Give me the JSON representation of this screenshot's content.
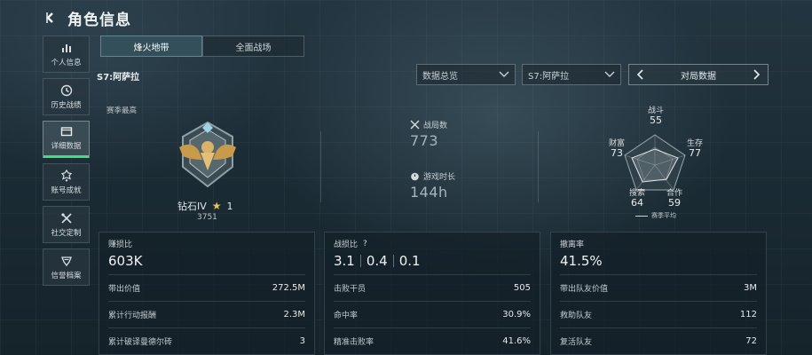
{
  "header": {
    "title": "角色信息"
  },
  "sidebar": {
    "items": [
      {
        "label": "个人信息"
      },
      {
        "label": "历史战绩"
      },
      {
        "label": "详细数据"
      },
      {
        "label": "账号成就"
      },
      {
        "label": "社交定制"
      },
      {
        "label": "信誉档案"
      }
    ],
    "active_index": 2,
    "accent_color": "#3de07a"
  },
  "tabs": [
    {
      "label": "烽火地带"
    },
    {
      "label": "全面战场"
    }
  ],
  "season": {
    "label": "S7:阿萨拉"
  },
  "filters": {
    "data_dropdown": "数据总览",
    "season_dropdown": "S7:阿萨拉",
    "pager_label": "对局数据"
  },
  "rank": {
    "section_label": "赛季最高",
    "name": "钻石IV",
    "stars": "1",
    "score": "3751"
  },
  "stats": {
    "matches_label": "战局数",
    "matches_value": "773",
    "playtime_label": "游戏时长",
    "playtime_value": "144h"
  },
  "radar": {
    "axes": [
      {
        "label": "战斗",
        "value": "55"
      },
      {
        "label": "生存",
        "value": "77"
      },
      {
        "label": "合作",
        "value": "59"
      },
      {
        "label": "搜索",
        "value": "64"
      },
      {
        "label": "财富",
        "value": "73"
      }
    ],
    "legend": "赛季平均"
  },
  "panels": {
    "p1": {
      "title": "赚损比",
      "value": "603K",
      "rows": [
        {
          "label": "带出价值",
          "value": "272.5M"
        },
        {
          "label": "累计行动报酬",
          "value": "2.3M"
        },
        {
          "label": "累计破译曼德尔砖",
          "value": "3"
        }
      ]
    },
    "p2": {
      "title": "战损比",
      "help": "?",
      "ratios": [
        "3.1",
        "0.4",
        "0.1"
      ],
      "rows": [
        {
          "label": "击败干员",
          "value": "505"
        },
        {
          "label": "命中率",
          "value": "30.9%"
        },
        {
          "label": "精准击败率",
          "value": "41.6%"
        }
      ]
    },
    "p3": {
      "title": "撤离率",
      "value": "41.5%",
      "rows": [
        {
          "label": "带出队友价值",
          "value": "3M"
        },
        {
          "label": "救助队友",
          "value": "112"
        },
        {
          "label": "复活队友",
          "value": "72"
        }
      ]
    }
  }
}
